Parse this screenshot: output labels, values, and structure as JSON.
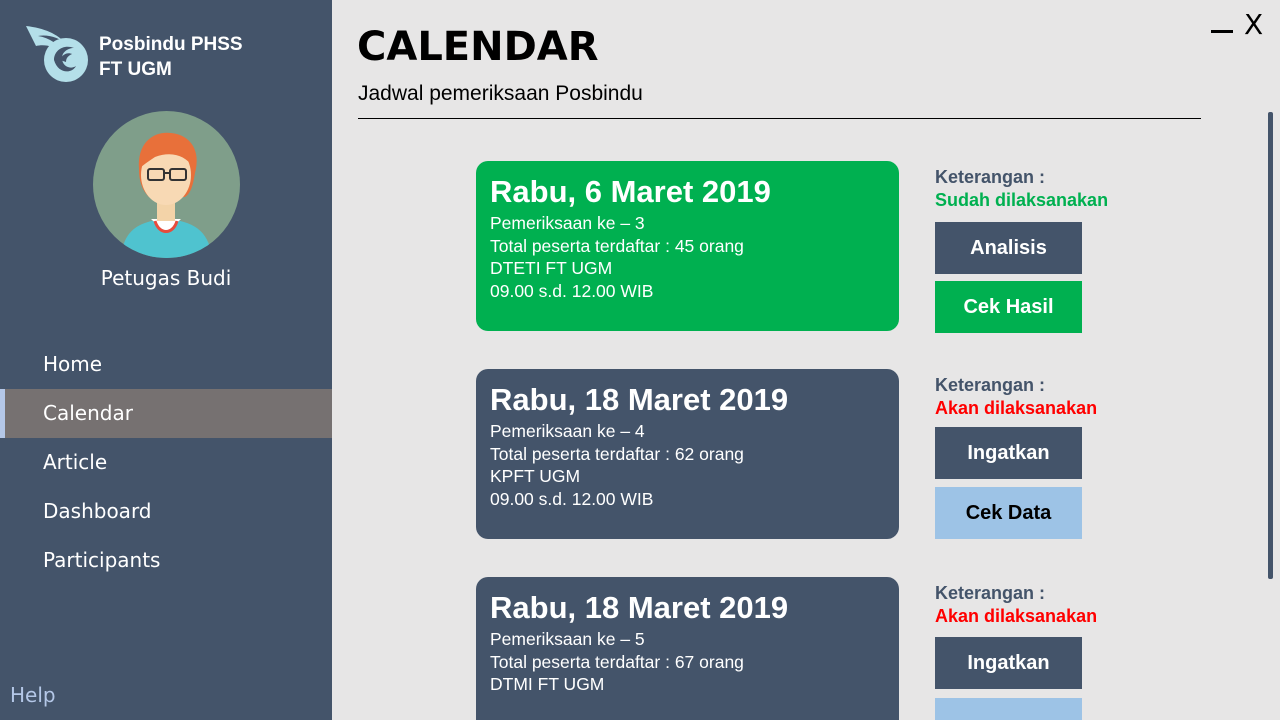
{
  "app": {
    "title_line1": "Posbindu PHSS",
    "title_line2": "FT UGM"
  },
  "user": {
    "name": "Petugas Budi"
  },
  "nav": {
    "items": [
      {
        "label": "Home",
        "active": false
      },
      {
        "label": "Calendar",
        "active": true
      },
      {
        "label": "Article",
        "active": false
      },
      {
        "label": "Dashboard",
        "active": false
      },
      {
        "label": "Participants",
        "active": false
      }
    ],
    "help": "Help"
  },
  "header": {
    "title": "CALENDAR",
    "subtitle": "Jadwal pemeriksaan Posbindu"
  },
  "window": {
    "close_glyph": "X"
  },
  "events": [
    {
      "date": "Rabu, 6 Maret 2019",
      "session": "Pemeriksaan ke – 3",
      "participants": "Total peserta terdaftar : 45 orang",
      "location": "DTETI FT UGM",
      "time": "09.00 s.d. 12.00 WIB",
      "status_label": "Keterangan :",
      "status": "Sudah dilaksanakan",
      "status_color": "#00b050",
      "buttons": [
        "Analisis",
        "Cek Hasil"
      ]
    },
    {
      "date": "Rabu,  18 Maret 2019",
      "session": "Pemeriksaan ke – 4",
      "participants": "Total peserta terdaftar : 62 orang",
      "location": "KPFT UGM",
      "time": "09.00 s.d. 12.00 WIB",
      "status_label": "Keterangan :",
      "status": "Akan dilaksanakan",
      "status_color": "#ff0000",
      "buttons": [
        "Ingatkan",
        "Cek Data"
      ]
    },
    {
      "date": "Rabu,  18 Maret 2019",
      "session": "Pemeriksaan ke – 5",
      "participants": "Total peserta terdaftar : 67 orang",
      "location": "DTMI FT UGM",
      "status_label": "Keterangan :",
      "status": "Akan dilaksanakan",
      "status_color": "#ff0000",
      "buttons": [
        "Ingatkan"
      ]
    }
  ],
  "colors": {
    "sidebar": "#44546a",
    "active_nav": "#767171",
    "background": "#e7e6e6",
    "done": "#00b050",
    "upcoming": "#ff0000",
    "light_button": "#9dc3e6"
  }
}
